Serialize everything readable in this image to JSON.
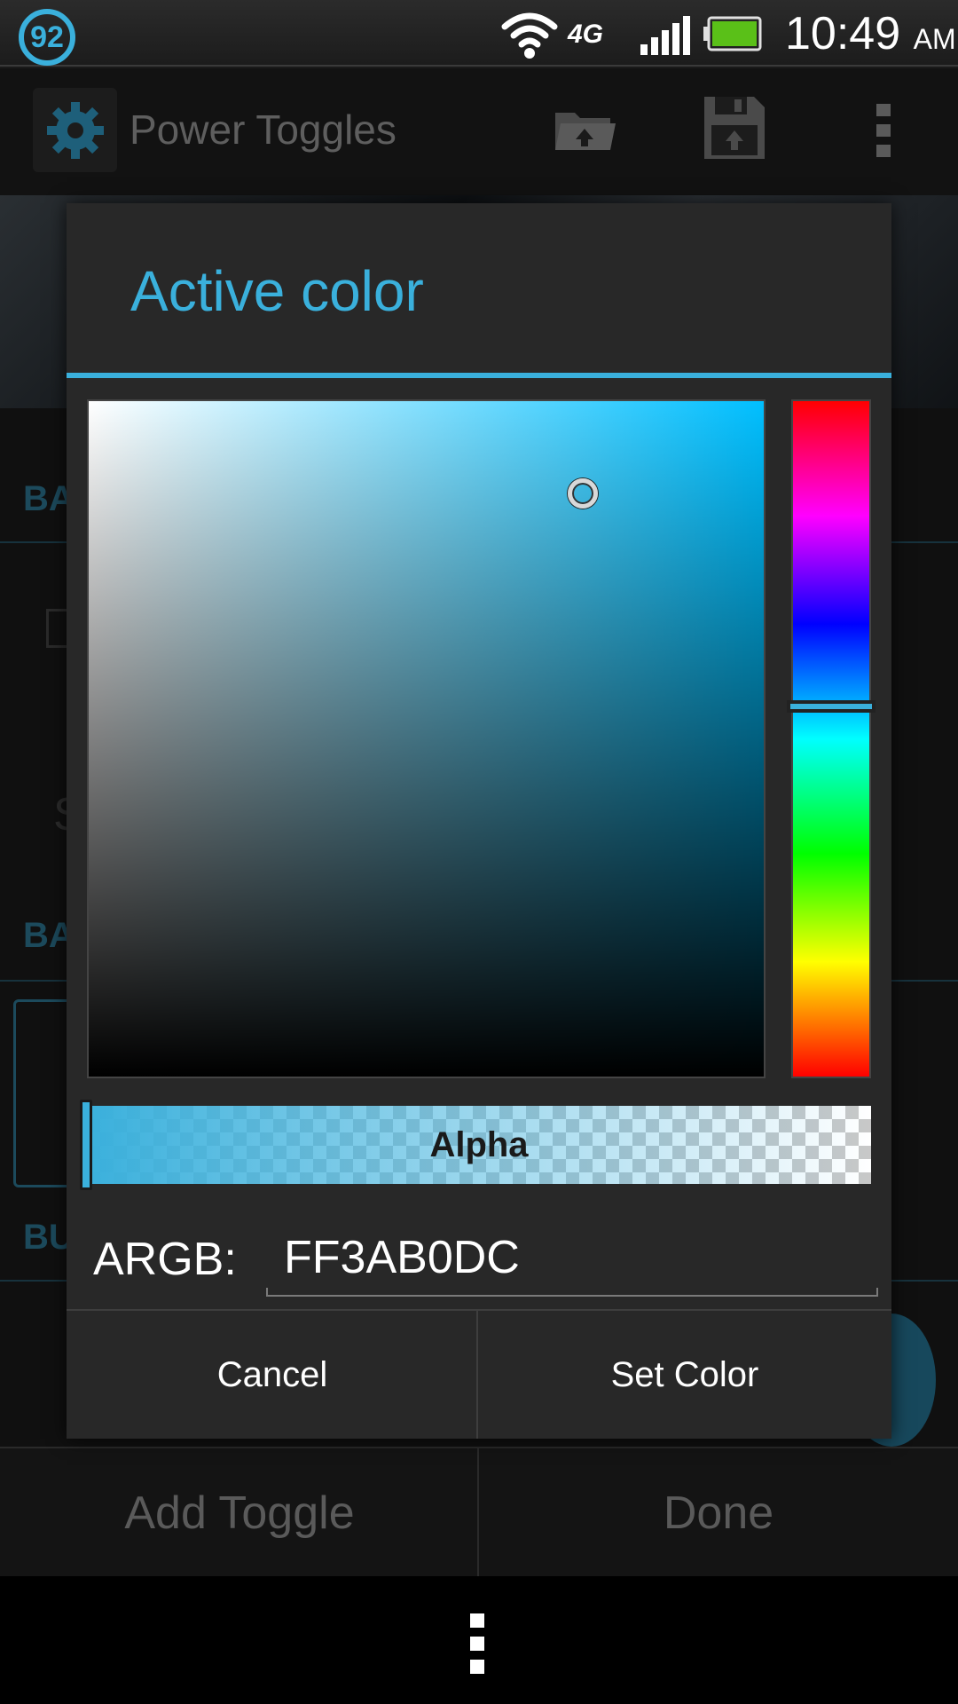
{
  "status_bar": {
    "notification_badge": "92",
    "network_type": "4G",
    "time": "10:49",
    "ampm": "AM"
  },
  "app": {
    "title": "Power Toggles",
    "sections": {
      "first": "BA",
      "second": "BA",
      "third": "BU"
    },
    "obscured_letter": "S",
    "bottom_actions": {
      "add_toggle": "Add Toggle",
      "done": "Done"
    }
  },
  "dialog": {
    "title": "Active color",
    "alpha_label": "Alpha",
    "argb_label": "ARGB:",
    "argb_value": "FF3AB0DC",
    "cancel_label": "Cancel",
    "set_color_label": "Set Color"
  },
  "colors": {
    "accent": "#3ab0dc",
    "selected_color": "#3AB0DC"
  },
  "icons": {
    "badge": "notification-badge-icon",
    "wifi": "wifi-icon",
    "signal": "signal-icon",
    "battery": "battery-icon",
    "gear": "gear-icon",
    "import": "folder-upload-icon",
    "save": "save-icon",
    "overflow": "overflow-menu-icon",
    "nav_menu": "nav-menu-icon"
  }
}
